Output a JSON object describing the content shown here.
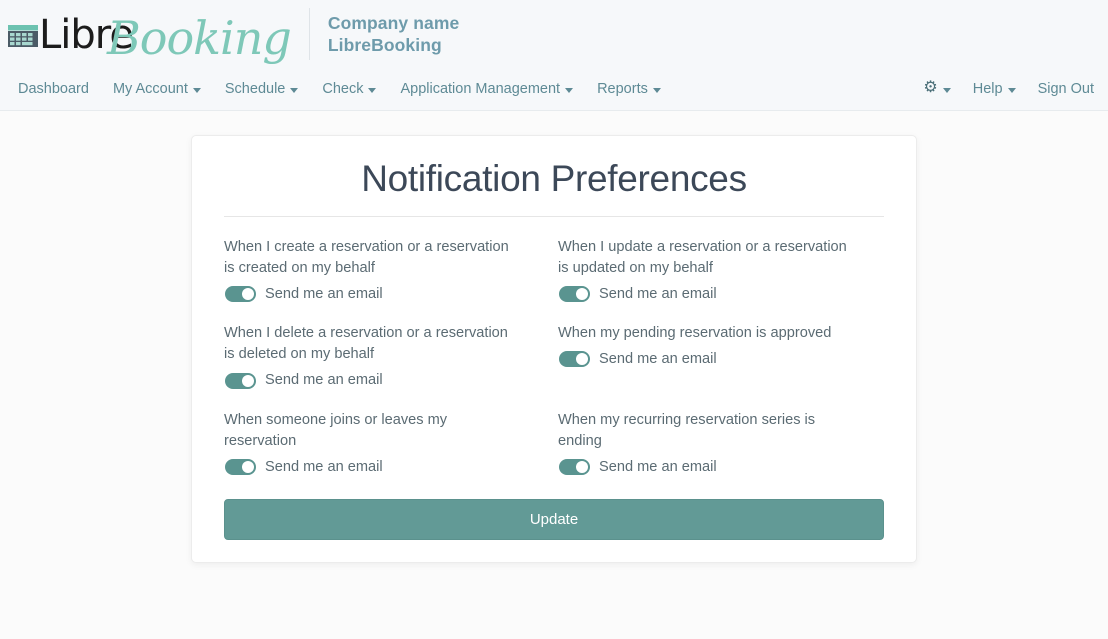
{
  "header": {
    "logo_word": "Libre",
    "logo_script": "Booking",
    "logo_icon": "calendar-grid-icon",
    "company_label": "Company name",
    "company_name": "LibreBooking"
  },
  "navbar": {
    "left_items": [
      {
        "label": "Dashboard",
        "has_caret": false
      },
      {
        "label": "My Account",
        "has_caret": true
      },
      {
        "label": "Schedule",
        "has_caret": true
      },
      {
        "label": "Check",
        "has_caret": true
      },
      {
        "label": "Application Management",
        "has_caret": true
      },
      {
        "label": "Reports",
        "has_caret": true
      }
    ],
    "right_items": [
      {
        "label": "",
        "icon": "gear-icon",
        "has_caret": true
      },
      {
        "label": "Help",
        "has_caret": true
      },
      {
        "label": "Sign Out",
        "has_caret": false
      }
    ]
  },
  "card": {
    "title": "Notification Preferences",
    "preferences": [
      {
        "label": "When I create a reservation or a reservation is created on my behalf",
        "toggle_label": "Send me an email",
        "enabled": true
      },
      {
        "label": "When I update a reservation or a reservation is updated on my behalf",
        "toggle_label": "Send me an email",
        "enabled": true
      },
      {
        "label": "When I delete a reservation or a reservation is deleted on my behalf",
        "toggle_label": "Send me an email",
        "enabled": true
      },
      {
        "label": "When my pending reservation is approved",
        "toggle_label": "Send me an email",
        "enabled": true
      },
      {
        "label": "When someone joins or leaves my reservation",
        "toggle_label": "Send me an email",
        "enabled": true
      },
      {
        "label": "When my recurring reservation series is ending",
        "toggle_label": "Send me an email",
        "enabled": true
      }
    ],
    "update_label": "Update"
  },
  "colors": {
    "accent_teal": "#629a96",
    "toggle_on": "#5a9490",
    "nav_text": "#5e8a95",
    "script_logo": "#7ec8b8",
    "page_bg": "#fbfbfb",
    "header_bg": "#f6f8fa"
  }
}
